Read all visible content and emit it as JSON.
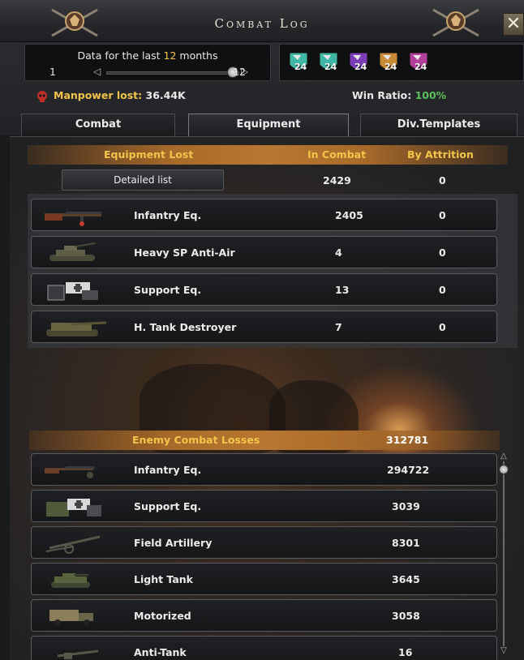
{
  "window": {
    "title": "Combat Log",
    "close_label": "✕"
  },
  "period": {
    "text_before": "Data for the last ",
    "months": "12",
    "text_after": " months",
    "min": "1",
    "max": "12",
    "slider_value": 12
  },
  "generals": [
    {
      "level": "24",
      "color": "#3fb7a4"
    },
    {
      "level": "24",
      "color": "#3fb7a4"
    },
    {
      "level": "24",
      "color": "#7a3fb7"
    },
    {
      "level": "24",
      "color": "#c88a35"
    },
    {
      "level": "24",
      "color": "#b23f9a"
    }
  ],
  "stats": {
    "manpower_label": "Manpower lost:",
    "manpower_value": "36.44K",
    "win_label": "Win Ratio:",
    "win_value": "100%"
  },
  "tabs": [
    {
      "label": "Combat",
      "active": false
    },
    {
      "label": "Equipment",
      "active": true
    },
    {
      "label": "Div.Templates",
      "active": false
    }
  ],
  "equipment_lost": {
    "header": {
      "col1": "Equipment Lost",
      "col2": "In Combat",
      "col3": "By Attrition"
    },
    "detailed_label": "Detailed list",
    "total_combat": "2429",
    "total_attrition": "0",
    "rows": [
      {
        "name": "Infantry Eq.",
        "combat": "2405",
        "attrition": "0",
        "icon": "rifle-icon"
      },
      {
        "name": "Heavy SP Anti-Air",
        "combat": "4",
        "attrition": "0",
        "icon": "sp-anti-air-icon"
      },
      {
        "name": "Support Eq.",
        "combat": "13",
        "attrition": "0",
        "icon": "support-equipment-icon"
      },
      {
        "name": "H. Tank Destroyer",
        "combat": "7",
        "attrition": "0",
        "icon": "tank-destroyer-icon"
      }
    ]
  },
  "enemy_losses": {
    "header": {
      "label": "Enemy Combat Losses",
      "total": "312781"
    },
    "rows": [
      {
        "name": "Infantry Eq.",
        "value": "294722",
        "icon": "rifle-icon"
      },
      {
        "name": "Support Eq.",
        "value": "3039",
        "icon": "support-equipment-icon"
      },
      {
        "name": "Field Artillery",
        "value": "8301",
        "icon": "artillery-icon"
      },
      {
        "name": "Light Tank",
        "value": "3645",
        "icon": "light-tank-icon"
      },
      {
        "name": "Motorized",
        "value": "3058",
        "icon": "truck-icon"
      },
      {
        "name": "Anti-Tank",
        "value": "16",
        "icon": "anti-tank-gun-icon"
      }
    ]
  }
}
